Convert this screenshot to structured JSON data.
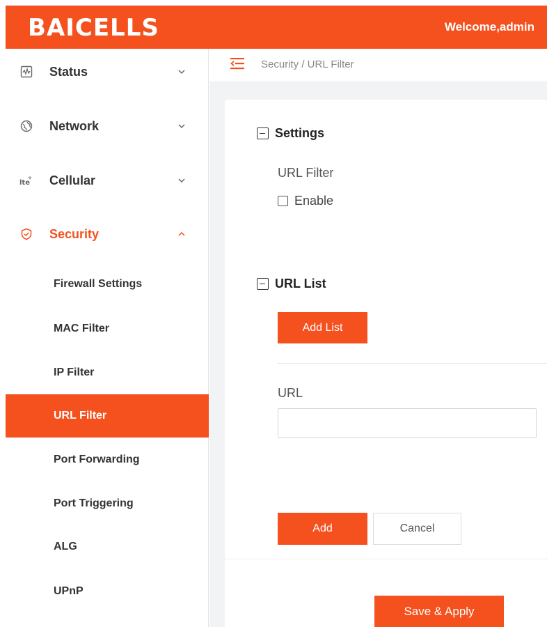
{
  "header": {
    "logo_text": "BAICELLS",
    "welcome": "Welcome,admin"
  },
  "sidebar": {
    "menus": [
      {
        "label": "Status",
        "icon": "status-chart-icon",
        "expanded": false
      },
      {
        "label": "Network",
        "icon": "globe-icon",
        "expanded": false
      },
      {
        "label": "Cellular",
        "icon": "lte-icon",
        "expanded": false
      },
      {
        "label": "Security",
        "icon": "shield-icon",
        "expanded": true
      }
    ],
    "security_items": [
      {
        "label": "Firewall Settings",
        "active": false
      },
      {
        "label": "MAC Filter",
        "active": false
      },
      {
        "label": "IP Filter",
        "active": false
      },
      {
        "label": "URL Filter",
        "active": true
      },
      {
        "label": "Port Forwarding",
        "active": false
      },
      {
        "label": "Port Triggering",
        "active": false
      },
      {
        "label": "ALG",
        "active": false
      },
      {
        "label": "UPnP",
        "active": false
      }
    ]
  },
  "breadcrumb": "Security / URL Filter",
  "settings": {
    "title": "Settings",
    "field_label": "URL Filter",
    "enable_label": "Enable",
    "enabled": false
  },
  "url_list": {
    "title": "URL List",
    "add_list_label": "Add List",
    "url_label": "URL",
    "url_value": "",
    "add_label": "Add",
    "cancel_label": "Cancel"
  },
  "footer": {
    "save_apply_label": "Save & Apply"
  },
  "colors": {
    "accent": "#f4511e",
    "content_bg": "#f2f3f5"
  }
}
